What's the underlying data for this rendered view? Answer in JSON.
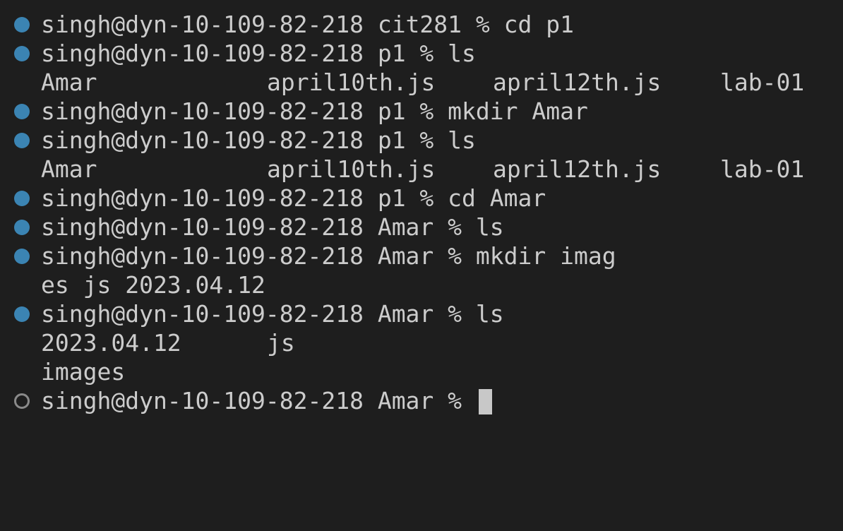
{
  "terminal": {
    "lines": [
      {
        "kind": "command",
        "status": "done",
        "text": "singh@dyn-10-109-82-218 cit281 % cd p1"
      },
      {
        "kind": "command",
        "status": "done",
        "text": "singh@dyn-10-109-82-218 p1 % ls"
      },
      {
        "kind": "output_columns",
        "cols": [
          "Amar",
          "april10th.js",
          "april12th.js",
          "lab-01"
        ]
      },
      {
        "kind": "command",
        "status": "done",
        "text": "singh@dyn-10-109-82-218 p1 % mkdir Amar"
      },
      {
        "kind": "command",
        "status": "done",
        "text": "singh@dyn-10-109-82-218 p1 % ls"
      },
      {
        "kind": "output_columns",
        "cols": [
          "Amar",
          "april10th.js",
          "april12th.js",
          "lab-01"
        ]
      },
      {
        "kind": "command",
        "status": "done",
        "text": "singh@dyn-10-109-82-218 p1 % cd Amar"
      },
      {
        "kind": "command",
        "status": "done",
        "text": "singh@dyn-10-109-82-218 Amar % ls"
      },
      {
        "kind": "command",
        "status": "done",
        "text": "singh@dyn-10-109-82-218 Amar % mkdir imag"
      },
      {
        "kind": "output",
        "text": "es js 2023.04.12"
      },
      {
        "kind": "command",
        "status": "done",
        "text": "singh@dyn-10-109-82-218 Amar % ls"
      },
      {
        "kind": "output_columns",
        "cols": [
          "2023.04.12",
          "js"
        ]
      },
      {
        "kind": "output",
        "text": "images"
      },
      {
        "kind": "prompt",
        "status": "pending",
        "text": "singh@dyn-10-109-82-218 Amar % "
      }
    ]
  },
  "colors": {
    "background": "#1e1e1e",
    "text": "#cccccc",
    "success_marker": "#3b84b3",
    "pending_marker": "#8a8a8a",
    "cursor": "#c8c8c8"
  }
}
